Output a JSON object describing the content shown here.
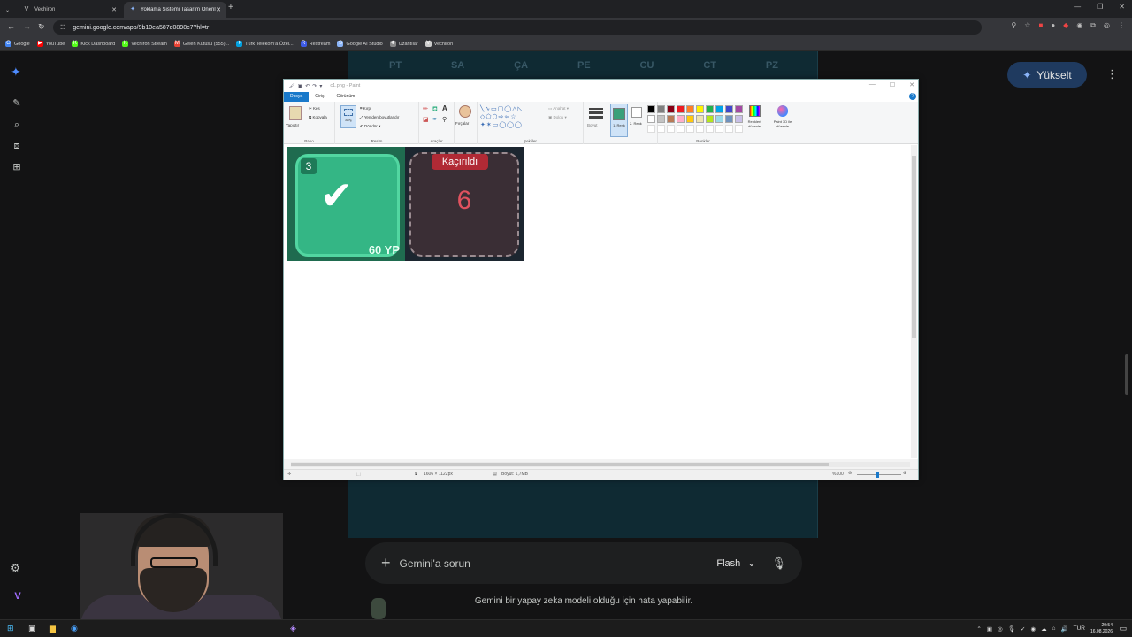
{
  "browser": {
    "tabs": [
      {
        "title": "Vechiron",
        "favicon": "V"
      },
      {
        "title": "Yoklama Sistemi Tasarım Öneril",
        "favicon": "✦"
      }
    ],
    "url": "gemini.google.com/app/9b10ea587d0898c7?hl=tr",
    "bookmarks": [
      {
        "label": "Google",
        "color": "#4285f4",
        "icon": "G"
      },
      {
        "label": "YouTube",
        "color": "#ff0000",
        "icon": "▶"
      },
      {
        "label": "Kick Dashboard",
        "color": "#53fc18",
        "icon": "K"
      },
      {
        "label": "Vechiron Stream",
        "color": "#53fc18",
        "icon": "K"
      },
      {
        "label": "Gelen Kutusu (555)...",
        "color": "#ea4335",
        "icon": "M"
      },
      {
        "label": "Türk Telekom'a Özel...",
        "color": "#00a0e0",
        "icon": "✈"
      },
      {
        "label": "Restream",
        "color": "#3c5ae6",
        "icon": "R"
      },
      {
        "label": "Google AI Studio",
        "color": "#8ab4f8",
        "icon": "S"
      },
      {
        "label": "Uzantılar",
        "color": "#888888",
        "icon": "❖"
      },
      {
        "label": "Vechiron",
        "color": "#cccccc",
        "icon": "V"
      }
    ]
  },
  "gemini": {
    "weekdays": [
      "PT",
      "SA",
      "ÇA",
      "PE",
      "CU",
      "CT",
      "PZ"
    ],
    "upgrade_label": "Yükselt",
    "prompt_placeholder": "Gemini'a sorun",
    "model_label": "Flash",
    "disclaimer": "Gemini bir yapay zeka modeli olduğu için hata yapabilir."
  },
  "paint": {
    "title": "c1.png - Paint",
    "ribbon_tabs": [
      "Dosya",
      "Giriş",
      "Görünüm"
    ],
    "clipboard": {
      "paste": "Yapıştır",
      "cut": "Kes",
      "copy": "Kopyala",
      "label": "Pano"
    },
    "image": {
      "select": "Seç",
      "crop": "Kırp",
      "resize": "Yeniden boyutlandır",
      "rotate": "Döndür",
      "label": "Resim"
    },
    "tools_label": "Araçlar",
    "brushes": "Fırçalar",
    "shapes": {
      "outline": "Anahat",
      "fill": "Dolgu",
      "label": "Şekiller"
    },
    "size": "Boyut",
    "color1": "1. Renk",
    "color2": "2. Renk",
    "colors_label": "Renkler",
    "edit_colors": "Renkleri düzenle",
    "paint3d": "Paint 3D ile düzenle",
    "palette": [
      "#000000",
      "#7f7f7f",
      "#880015",
      "#ed1c24",
      "#ff7f27",
      "#fff200",
      "#22b14c",
      "#00a2e8",
      "#3f48cc",
      "#a349a4",
      "#ffffff",
      "#c3c3c3",
      "#b97a57",
      "#ffaec9",
      "#ffc90e",
      "#efe4b0",
      "#b5e61d",
      "#99d9ea",
      "#7092be",
      "#c8bfe7"
    ],
    "status": {
      "dimensions": "1606 × 1122px",
      "size": "Boyut: 1,7MB",
      "zoom": "%100"
    },
    "cards": {
      "green_number": "3",
      "green_xp": "60 YP",
      "red_tag": "Kaçırıldı",
      "red_value": "6"
    }
  },
  "taskbar": {
    "lang": "TUR",
    "time": "20:54",
    "date": "16.08.2026"
  }
}
